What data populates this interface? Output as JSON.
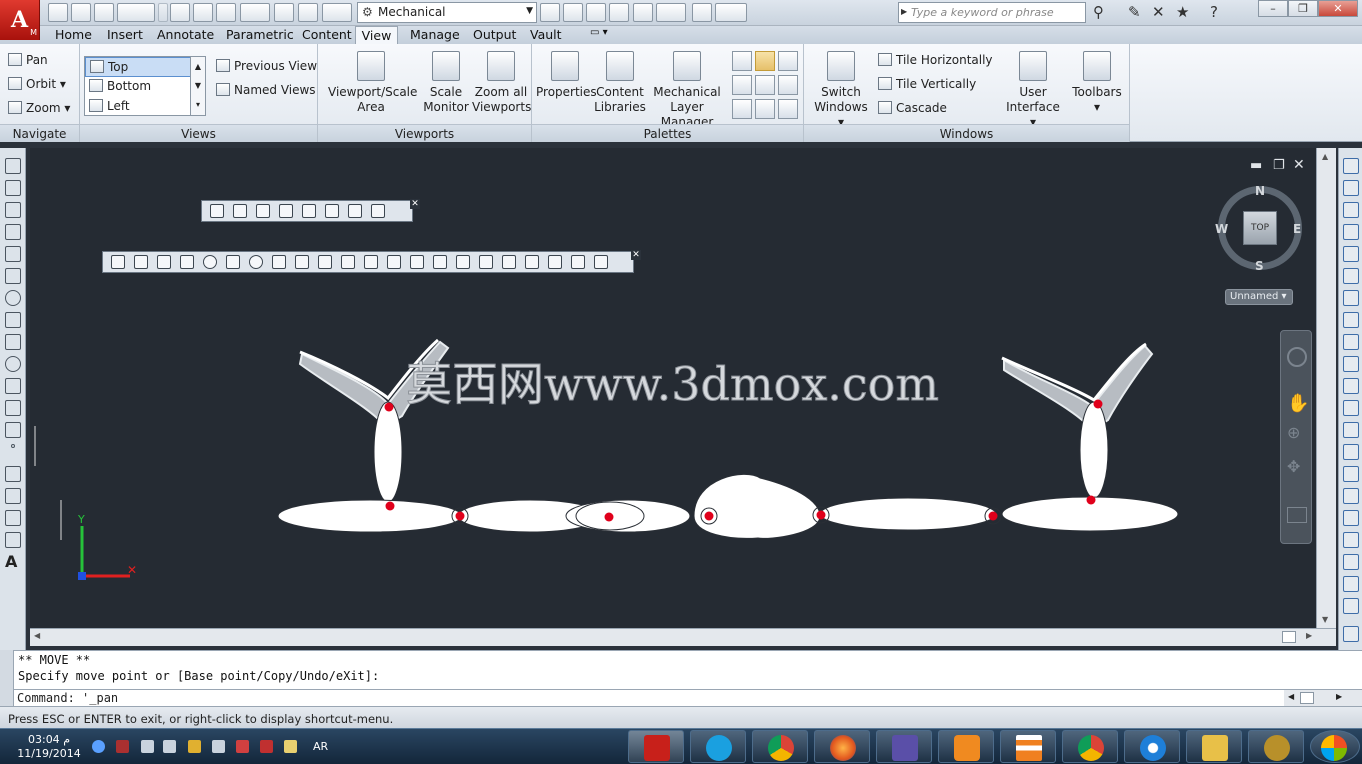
{
  "app": {
    "logo_letter": "A",
    "logo_sub": "M"
  },
  "workspace": {
    "selected": "Mechanical"
  },
  "search": {
    "placeholder": "Type a keyword or phrase"
  },
  "tabs": [
    "Home",
    "Insert",
    "Annotate",
    "Parametric",
    "Content",
    "View",
    "Manage",
    "Output",
    "Vault"
  ],
  "active_tab": "View",
  "navigate": {
    "title": "Navigate",
    "pan": "Pan",
    "orbit": "Orbit",
    "zoom": "Zoom"
  },
  "views": {
    "title": "Views",
    "list": [
      "Top",
      "Bottom",
      "Left"
    ],
    "selected": "Top",
    "previous": "Previous View",
    "named": "Named Views"
  },
  "viewports": {
    "title": "Viewports",
    "scale_area": [
      "Viewport/Scale",
      "Area"
    ],
    "scale_monitor": [
      "Scale",
      "Monitor"
    ],
    "zoom_all": [
      "Zoom all",
      "Viewports"
    ]
  },
  "palettes": {
    "title": "Palettes",
    "properties": "Properties",
    "content_libraries": [
      "Content",
      "Libraries"
    ],
    "layer_manager": [
      "Mechanical",
      "Layer Manager"
    ]
  },
  "windows": {
    "title": "Windows",
    "switch": [
      "Switch",
      "Windows"
    ],
    "tile_h": "Tile Horizontally",
    "tile_v": "Tile Vertically",
    "cascade": "Cascade",
    "user_interface": [
      "User",
      "Interface"
    ],
    "toolbars": "Toolbars"
  },
  "viewcube": {
    "top": "TOP",
    "n": "N",
    "s": "S",
    "e": "E",
    "w": "W",
    "ucs": "Unnamed"
  },
  "watermark": "莫西网www.3dmox.com",
  "command": {
    "line1": "** MOVE **",
    "line2": "Specify move point or [Base point/Copy/Undo/eXit]:",
    "input": "Command: '_pan"
  },
  "status": "Press ESC or ENTER to exit, or right-click to display shortcut-menu.",
  "taskbar": {
    "time": "03:04 م",
    "date": "11/19/2014",
    "lang": "AR"
  },
  "colors": {
    "accent_red": "#e0001b",
    "canvas": "#252b33"
  }
}
